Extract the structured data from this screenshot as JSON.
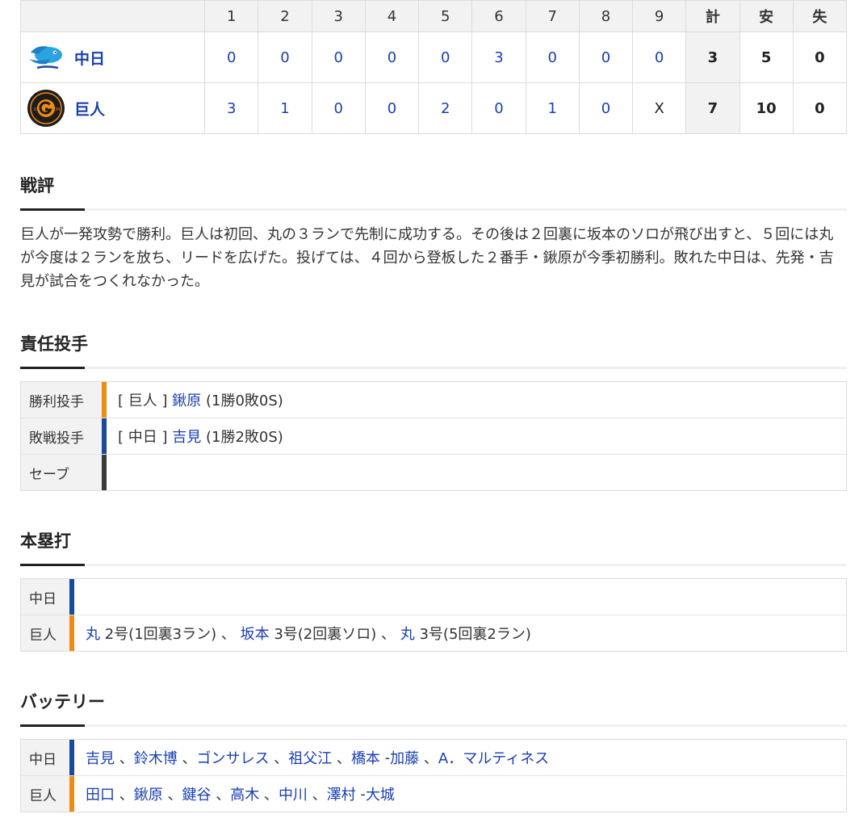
{
  "scoreboard": {
    "innings": [
      "1",
      "2",
      "3",
      "4",
      "5",
      "6",
      "7",
      "8",
      "9"
    ],
    "sum_label": "計",
    "hit_label": "安",
    "err_label": "失",
    "teams": [
      {
        "name": "中日",
        "scores": [
          "0",
          "0",
          "0",
          "0",
          "0",
          "3",
          "0",
          "0",
          "0"
        ],
        "total": "3",
        "hits": "5",
        "errors": "0"
      },
      {
        "name": "巨人",
        "scores": [
          "3",
          "1",
          "0",
          "0",
          "2",
          "0",
          "1",
          "0",
          "X"
        ],
        "total": "7",
        "hits": "10",
        "errors": "0"
      }
    ]
  },
  "review": {
    "title": "戦評",
    "text": "巨人が一発攻勢で勝利。巨人は初回、丸の３ランで先制に成功する。その後は２回裏に坂本のソロが飛び出すと、５回には丸が今度は２ランを放ち、リードを広げた。投げては、４回から登板した２番手・鍬原が今季初勝利。敗れた中日は、先発・吉見が試合をつくれなかった。"
  },
  "pitchers": {
    "title": "責任投手",
    "rows": [
      {
        "label": "勝利投手",
        "team": "[ 巨人 ]",
        "name": "鍬原",
        "record": "(1勝0敗0S)"
      },
      {
        "label": "敗戦投手",
        "team": "[ 中日 ]",
        "name": "吉見",
        "record": "(1勝2敗0S)"
      },
      {
        "label": "セーブ",
        "team": "",
        "name": "",
        "record": ""
      }
    ]
  },
  "homeruns": {
    "title": "本塁打",
    "rows": [
      {
        "label": "中日",
        "items": []
      },
      {
        "label": "巨人",
        "items": [
          {
            "name": "丸",
            "detail": "2号(1回裏3ラン)"
          },
          {
            "name": "坂本",
            "detail": "3号(2回裏ソロ)"
          },
          {
            "name": "丸",
            "detail": "3号(5回裏2ラン)"
          }
        ]
      }
    ]
  },
  "battery": {
    "title": "バッテリー",
    "rows": [
      {
        "label": "中日",
        "pitchers": [
          "吉見",
          "鈴木博",
          "ゴンサレス",
          "祖父江",
          "橋本"
        ],
        "catchers": [
          "加藤",
          "A．マルティネス"
        ]
      },
      {
        "label": "巨人",
        "pitchers": [
          "田口",
          "鍬原",
          "鍵谷",
          "高木",
          "中川",
          "澤村"
        ],
        "catchers": [
          "大城"
        ]
      }
    ]
  },
  "colors": {
    "link": "#1a3fb0",
    "giants": "#ef8a14",
    "dragons": "#1a4a9a"
  }
}
